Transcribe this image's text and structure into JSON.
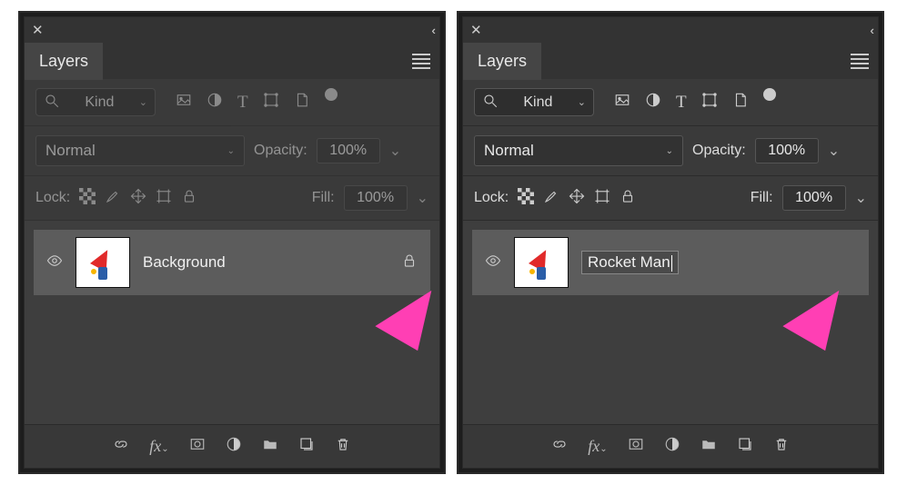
{
  "panels": [
    {
      "title": "Layers",
      "disabled": true,
      "filter": {
        "label": "Kind"
      },
      "blend": {
        "value": "Normal",
        "label": "Opacity:",
        "pct": "100%"
      },
      "lock": {
        "label": "Lock:",
        "fill_label": "Fill:",
        "pct": "100%"
      },
      "layer": {
        "name": "Background",
        "editing": false,
        "locked": true,
        "selected": false
      },
      "cursor": "a1"
    },
    {
      "title": "Layers",
      "disabled": false,
      "filter": {
        "label": "Kind"
      },
      "blend": {
        "value": "Normal",
        "label": "Opacity:",
        "pct": "100%"
      },
      "lock": {
        "label": "Lock:",
        "fill_label": "Fill:",
        "pct": "100%"
      },
      "layer": {
        "name": "Rocket Man",
        "editing": true,
        "locked": false,
        "selected": true
      },
      "cursor": "a2"
    }
  ],
  "icons": {
    "close": "✕",
    "collapse": "‹‹",
    "search": "🔍",
    "image_type": "▣",
    "adjust_type": "◐",
    "text_type": "T",
    "shape_type": "⬚",
    "smart_type": "🗋",
    "chev": "⌄",
    "lock_pixels": "▦",
    "lock_brush": "✎",
    "lock_move": "✥",
    "lock_artboard": "⬚",
    "lock_all": "🔒",
    "eye": "👁",
    "lock_badge": "🔒",
    "link": "⧉",
    "fx": "fx",
    "mask": "◼",
    "adjustment": "◐",
    "group": "📁",
    "new": "⧉",
    "trash": "🗑"
  }
}
